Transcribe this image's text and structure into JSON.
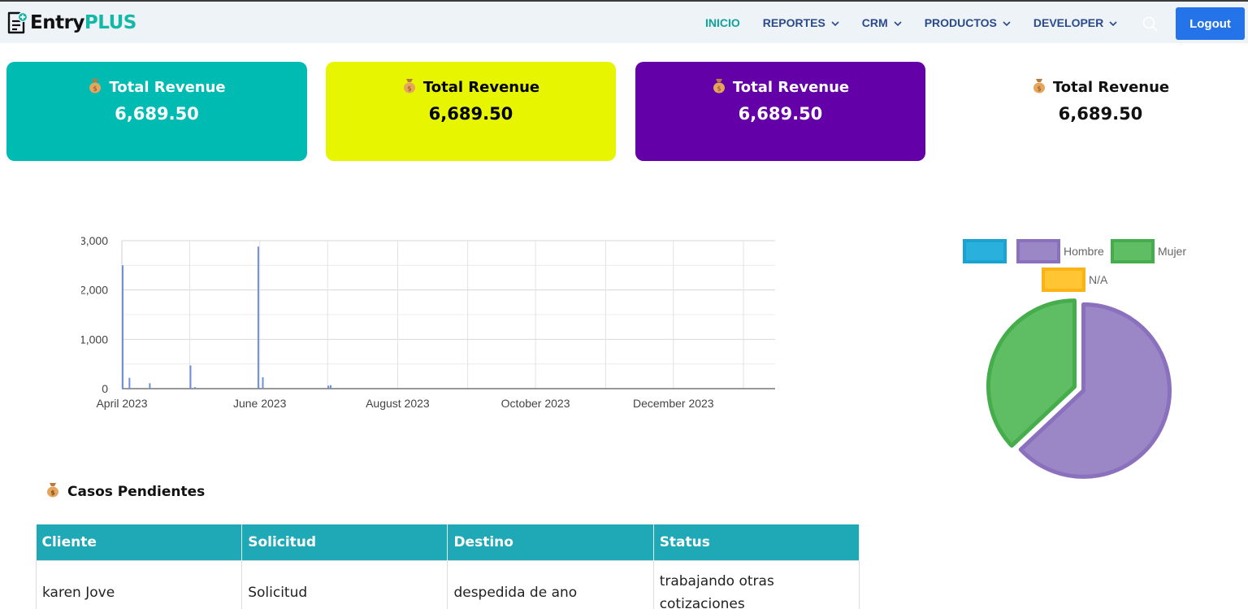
{
  "brand": {
    "entry": "Entry",
    "plus": "PLUS"
  },
  "nav": {
    "items": [
      {
        "label": "INICIO",
        "dropdown": false,
        "active": true
      },
      {
        "label": "REPORTES",
        "dropdown": true,
        "active": false
      },
      {
        "label": "CRM",
        "dropdown": true,
        "active": false
      },
      {
        "label": "PRODUCTOS",
        "dropdown": true,
        "active": false
      },
      {
        "label": "DEVELOPER",
        "dropdown": true,
        "active": false
      }
    ],
    "logout": "Logout"
  },
  "cards": [
    {
      "title": "Total Revenue",
      "value": "6,689.50",
      "bg": "#00bbb2",
      "fg": "#ffffff"
    },
    {
      "title": "Total Revenue",
      "value": "6,689.50",
      "bg": "#e8f500",
      "fg": "#000000"
    },
    {
      "title": "Total Revenue",
      "value": "6,689.50",
      "bg": "#6400a8",
      "fg": "#ffffff"
    },
    {
      "title": "Total Revenue",
      "value": "6,689.50",
      "bg": "#ffffff",
      "fg": "#111111"
    }
  ],
  "chart_data": [
    {
      "type": "bar",
      "x_axis": {
        "type": "time",
        "ticks": [
          "April 2023",
          "June 2023",
          "August 2023",
          "October 2023",
          "December 2023"
        ]
      },
      "y_axis": {
        "ticks": [
          "0",
          "1,000",
          "2,000",
          "3,000"
        ],
        "ylim": [
          0,
          3000
        ]
      },
      "grid": true,
      "color": "#6f8fd8",
      "points": [
        {
          "x": "2023-04-01",
          "y": 2500
        },
        {
          "x": "2023-04-04",
          "y": 220
        },
        {
          "x": "2023-04-13",
          "y": 110
        },
        {
          "x": "2023-05-01",
          "y": 470
        },
        {
          "x": "2023-05-03",
          "y": 30
        },
        {
          "x": "2023-05-31",
          "y": 2880
        },
        {
          "x": "2023-06-02",
          "y": 230
        },
        {
          "x": "2023-07-01",
          "y": 60
        },
        {
          "x": "2023-07-02",
          "y": 70
        }
      ]
    },
    {
      "type": "pie",
      "legend": [
        {
          "label": "",
          "color": "#1aa3d1",
          "fill": "#2ab0dd"
        },
        {
          "label": "Hombre",
          "color": "#8a70bd",
          "fill": "#9b86c6"
        },
        {
          "label": "Mujer",
          "color": "#46ad4c",
          "fill": "#5fbe63"
        },
        {
          "label": "N/A",
          "color": "#fbb416",
          "fill": "#ffc533"
        }
      ],
      "values": [
        0,
        63,
        37,
        0
      ]
    }
  ],
  "casos": {
    "title": "Casos Pendientes",
    "columns": [
      "Cliente",
      "Solicitud",
      "Destino",
      "Status"
    ],
    "rows": [
      [
        "karen Jove",
        "Solicitud",
        "despedida de ano",
        "trabajando otras cotizaciones"
      ]
    ]
  }
}
